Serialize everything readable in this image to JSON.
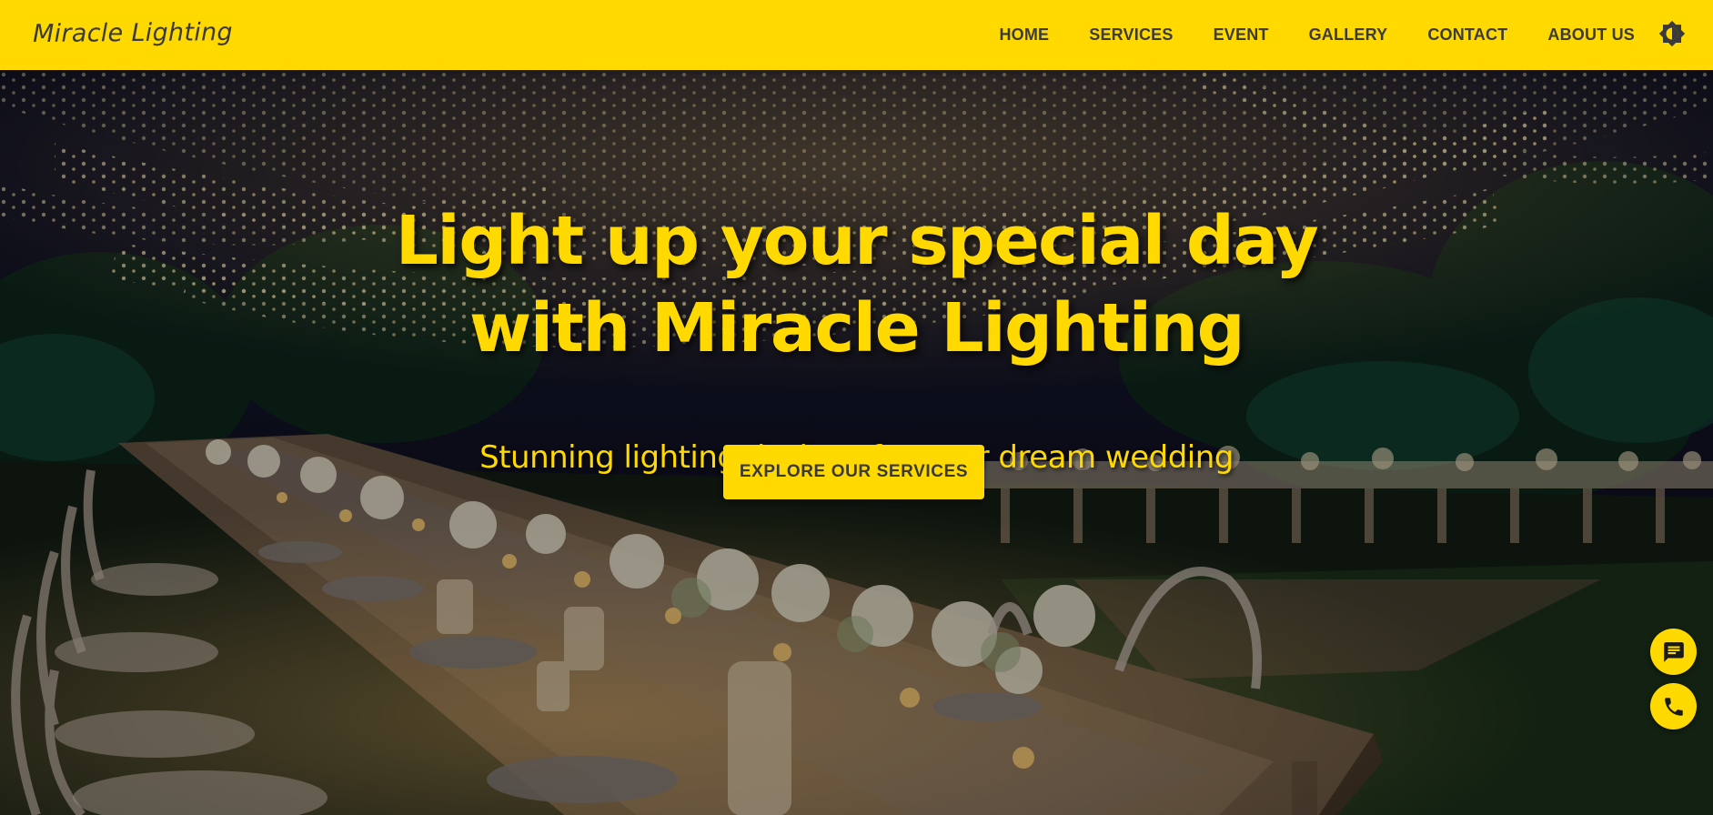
{
  "header": {
    "brand": "Miracle Lighting",
    "nav": [
      "HOME",
      "SERVICES",
      "EVENT",
      "GALLERY",
      "CONTACT",
      "ABOUT US"
    ],
    "theme_toggle_icon": "brightness-icon"
  },
  "hero": {
    "title_line1": "Light up your special day",
    "title_line2": "with Miracle Lighting",
    "subtitle": "Stunning lighting designs for your dream wedding",
    "cta_label": "EXPLORE OUR SERVICES",
    "background_icon": "wedding-reception-string-lights-photo"
  },
  "floating_actions": {
    "chat_icon": "chat-icon",
    "call_icon": "phone-icon"
  },
  "colors": {
    "accent": "#ffd900",
    "text_dark": "#3a3a3a"
  }
}
